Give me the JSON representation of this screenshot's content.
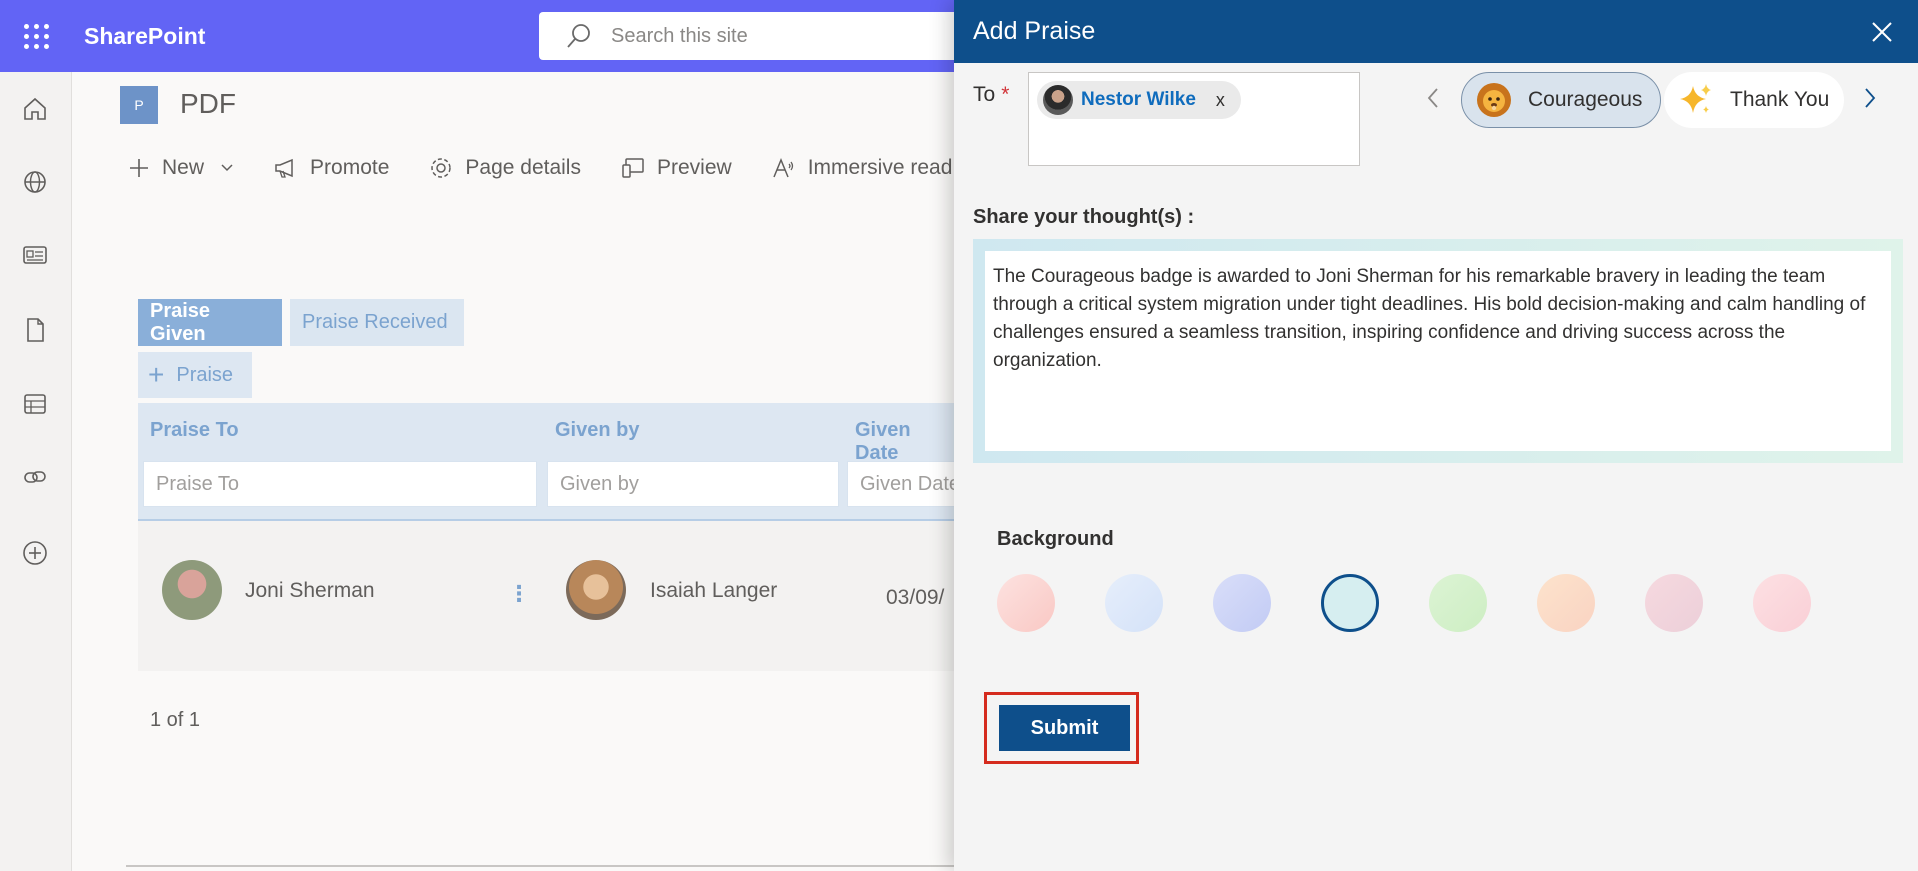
{
  "suitebar": {
    "brand": "SharePoint",
    "search_placeholder": "Search this site"
  },
  "rail": {
    "items": [
      "home-icon",
      "globe-icon",
      "news-icon",
      "document-icon",
      "list-icon",
      "link-icon",
      "add-icon"
    ]
  },
  "page": {
    "site_logo_letter": "P",
    "site_title": "PDF",
    "commands": {
      "new": "New",
      "promote": "Promote",
      "page_details": "Page details",
      "preview": "Preview",
      "immersive_reader": "Immersive read"
    }
  },
  "praise": {
    "tabs": [
      "Praise Given",
      "Praise Received"
    ],
    "add_label": "Praise",
    "columns": [
      "Praise To",
      "Given by",
      "Given Date"
    ],
    "filters": [
      "Praise To",
      "Given by",
      "Given Date"
    ],
    "rows": [
      {
        "praise_to": "Joni Sherman",
        "given_by": "Isaiah Langer",
        "date": "03/09/"
      }
    ],
    "pager": "1 of 1"
  },
  "panel": {
    "title": "Add Praise",
    "to_label": "To",
    "required_mark": "*",
    "recipient": {
      "name": "Nestor Wilke",
      "remove": "x"
    },
    "badges": [
      {
        "label": "Courageous",
        "icon": "lion-emoji",
        "selected": true
      },
      {
        "label": "Thank You",
        "icon": "sparkles-emoji",
        "selected": false
      }
    ],
    "share_label": "Share your thought(s) :",
    "thought_text": "The Courageous badge is awarded to Joni Sherman for his remarkable bravery in leading the team through a critical system migration under tight deadlines. His bold decision-making and calm handling of challenges ensured a seamless transition, inspiring confidence and driving success across the organization.",
    "background_label": "Background",
    "background_options": [
      {
        "colors": [
          "#fde2e0",
          "#f9c8c4"
        ],
        "selected": false
      },
      {
        "colors": [
          "#e6eefb",
          "#d4e2f8"
        ],
        "selected": false
      },
      {
        "colors": [
          "#d9def9",
          "#c2cbf4"
        ],
        "selected": false
      },
      {
        "colors": [
          "#d6eef0",
          "#d6eef0"
        ],
        "selected": true
      },
      {
        "colors": [
          "#dcf3d4",
          "#cdeec3"
        ],
        "selected": false
      },
      {
        "colors": [
          "#fde3cc",
          "#f9d3c2"
        ],
        "selected": false
      },
      {
        "colors": [
          "#f6d9df",
          "#eccfd9"
        ],
        "selected": false
      },
      {
        "colors": [
          "#fde0e3",
          "#f9cfd6"
        ],
        "selected": false
      }
    ],
    "submit_label": "Submit"
  },
  "colors": {
    "suitebar": "#6264f5",
    "panel_header": "#0e4f8b",
    "accent": "#0e4f8b",
    "highlight": "#d52b1e"
  }
}
